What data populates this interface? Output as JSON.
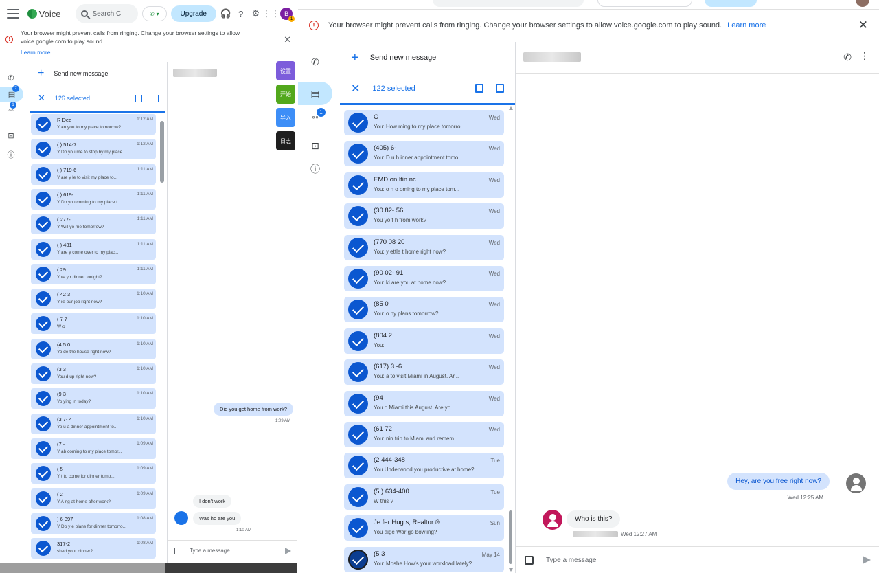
{
  "left": {
    "app_name": "Voice",
    "search_placeholder": "Search C",
    "upgrade_label": "Upgrade",
    "avatar_initial": "B",
    "banner_text": "Your browser might prevent calls from ringing. Change your browser settings to allow voice.google.com to play sound.",
    "banner_link": "Learn more",
    "rail_badges": {
      "messages": "7",
      "voicemail": "1"
    },
    "new_message_label": "Send new message",
    "selected_label": "126 selected",
    "rows": [
      {
        "name": "R   Dee",
        "preview": "Y   an you   to my place tomorrow?",
        "time": "1:12 AM"
      },
      {
        "name": "(   ) 514-7",
        "preview": "Y   Do you   me to stop by my place...",
        "time": "1:12 AM"
      },
      {
        "name": "(   ) 719-6",
        "preview": "Y   are y   le to visit my place to...",
        "time": "1:11 AM"
      },
      {
        "name": "(   ) 619-",
        "preview": "Y   Do you   coming to my place t...",
        "time": "1:11 AM"
      },
      {
        "name": "(   277-",
        "preview": "Y   Will yo   me tomorrow?",
        "time": "1:11 AM"
      },
      {
        "name": "(   ) 431",
        "preview": "Y   are y   come over to my plac...",
        "time": "1:11 AM"
      },
      {
        "name": "(   29",
        "preview": "Y   re y   r dinner tonight?",
        "time": "1:11 AM"
      },
      {
        "name": "(   42   3",
        "preview": "Y   re   our job right now?",
        "time": "1:10 AM"
      },
      {
        "name": "(   7   7",
        "preview": "W   o",
        "time": "1:10 AM"
      },
      {
        "name": "(4   5   0",
        "preview": "Yo   de the house right now?",
        "time": "1:10 AM"
      },
      {
        "name": "(3   3",
        "preview": "You   d up right now?",
        "time": "1:10 AM"
      },
      {
        "name": "(9   3",
        "preview": "Yo   ying in today?",
        "time": "1:10 AM"
      },
      {
        "name": "(3   7-   4",
        "preview": "Yo   u   a dinner appointment to...",
        "time": "1:10 AM"
      },
      {
        "name": "(7   -",
        "preview": "Y   ab   coming to my place tomor...",
        "time": "1:09 AM"
      },
      {
        "name": "(   5",
        "preview": "Y   t to come for dinner tomo...",
        "time": "1:09 AM"
      },
      {
        "name": "(   2",
        "preview": "Y   A   ng at home after work?",
        "time": "1:09 AM"
      },
      {
        "name": "   ) 6   397",
        "preview": "Y   Do y   e plans for dinner tomorro...",
        "time": "1:08 AM"
      },
      {
        "name": "   317-2",
        "preview": "   shed your dinner?",
        "time": "1:08 AM"
      }
    ],
    "messages": {
      "out_text": "Did you get home from work?",
      "out_time": "1:09 AM",
      "in1_text": "I don't work",
      "in2_text": "Was ho are you",
      "in2_time": "1:10 AM"
    },
    "compose_placeholder": "Type a message",
    "ext_buttons": [
      {
        "label": "设置",
        "color": "#7c5cdb"
      },
      {
        "label": "开始",
        "color": "#52a81c"
      },
      {
        "label": "导入",
        "color": "#3d8ef7"
      },
      {
        "label": "日志",
        "color": "#1f1f1f"
      }
    ]
  },
  "right": {
    "banner_text": "Your browser might prevent calls from ringing. Change your browser settings to allow voice.google.com to play sound.",
    "banner_link": "Learn more",
    "rail_badges": {
      "voicemail": "1"
    },
    "new_message_label": "Send new message",
    "selected_label": "122 selected",
    "rows": [
      {
        "name": "   O",
        "preview": "You: How   ming to my place tomorro...",
        "time": "Wed"
      },
      {
        "name": "(405)   6-",
        "preview": "You: D   u h   inner appointment tomo...",
        "time": "Wed"
      },
      {
        "name": "EMD   on   ltin   nc.",
        "preview": "You:   o   n o   oming to my place tom...",
        "time": "Wed"
      },
      {
        "name": "(30   82-   56",
        "preview": "You   yo   t h   from work?",
        "time": "Wed"
      },
      {
        "name": "(770   08   20",
        "preview": "You:   y   ettle   t home right now?",
        "time": "Wed"
      },
      {
        "name": "(90   02-   91",
        "preview": "You:   ki   are you at home now?",
        "time": "Wed"
      },
      {
        "name": "(85   0",
        "preview": "You:   o   ny plans tomorrow?",
        "time": "Wed"
      },
      {
        "name": "(804   2",
        "preview": "You:",
        "time": "Wed"
      },
      {
        "name": "(617)   3   -6",
        "preview": "You:   a   to visit Miami in August. Ar...",
        "time": "Wed"
      },
      {
        "name": "(94",
        "preview": "You   o Miami this August. Are yo...",
        "time": "Wed"
      },
      {
        "name": "(61   72",
        "preview": "You:   nin   trip to Miami and remem...",
        "time": "Wed"
      },
      {
        "name": "(2   444-348",
        "preview": "You   Underwood   you productive at home?",
        "time": "Tue"
      },
      {
        "name": "(5   ) 634-400",
        "preview": "W   this ?",
        "time": "Tue"
      },
      {
        "name": "Je   fer Hug   s, Realtor ®",
        "preview": "You   aige War   go bowling?",
        "time": "Sun"
      },
      {
        "name": "(5   3",
        "preview": "You: Moshe How's your workload lately?",
        "time": "May 14"
      }
    ],
    "messages": {
      "out_text": "Hey, are you free right now?",
      "out_time": "Wed 12:25 AM",
      "in_text": "Who is this?",
      "in_time": "Wed 12:27 AM"
    },
    "compose_placeholder": "Type a message"
  }
}
